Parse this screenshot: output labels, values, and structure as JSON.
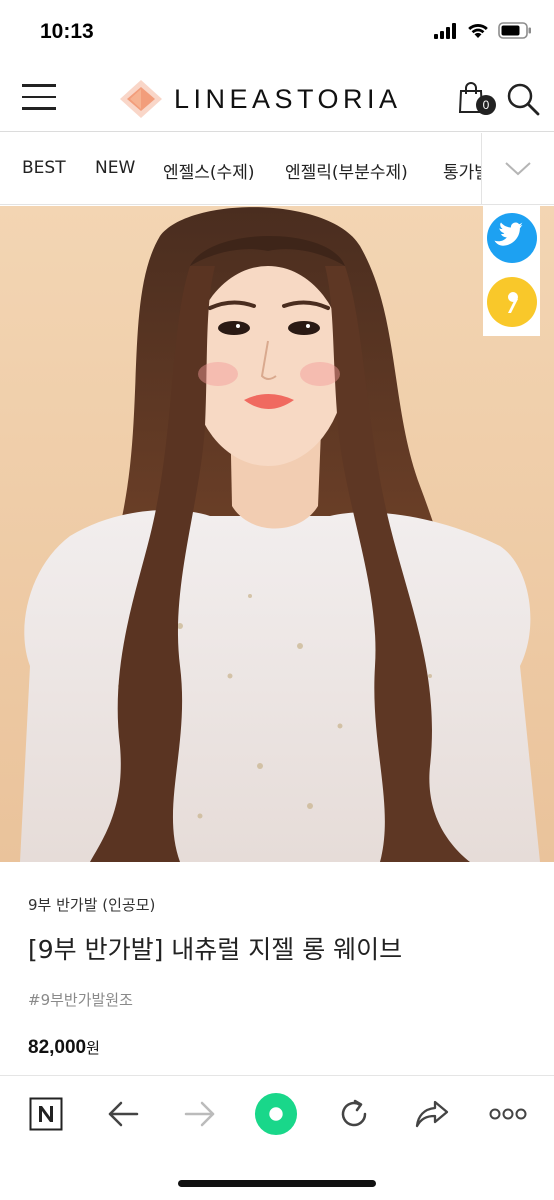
{
  "status_bar": {
    "time": "10:13",
    "icons": [
      "cellular-signal-icon",
      "wifi-icon",
      "battery-icon"
    ]
  },
  "header": {
    "logo_text": "LINEASTORIA",
    "cart_count": "0",
    "icons": [
      "menu-icon",
      "logo-mark-icon",
      "shopping-bag-icon",
      "search-icon"
    ]
  },
  "category_nav": {
    "items": [
      "BEST",
      "NEW",
      "엔젤스(수제)",
      "엔젤릭(부분수제)",
      "통가발"
    ],
    "more_icon": "chevron-down-icon"
  },
  "hero": {
    "image": "model-long-wavy-brown-hair-photo",
    "share": [
      "twitter-icon",
      "kakaostory-icon"
    ]
  },
  "product": {
    "category": "9부 반가발 (인공모)",
    "title": "[9부 반가발] 내츄럴 지젤 롱 웨이브",
    "tag": "#9부반가발원조",
    "price": "82,000",
    "currency": "원"
  },
  "toolbar": {
    "icons": [
      "naver-n-icon",
      "back-arrow-icon",
      "forward-arrow-icon",
      "green-dot-icon",
      "refresh-icon",
      "share-icon",
      "more-options-icon"
    ]
  },
  "colors": {
    "logo_accent": "#ef8a62",
    "twitter": "#1da1f2",
    "kakao": "#f9c82a",
    "green_button": "#19d78a",
    "hero_background": "#f0cfa9"
  }
}
